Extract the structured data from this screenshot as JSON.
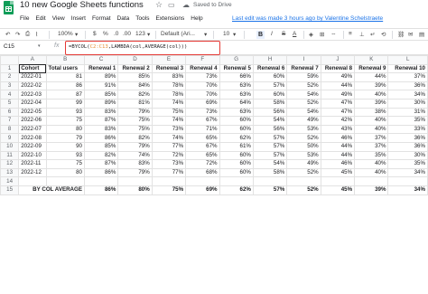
{
  "app": {
    "title": "10 new Google Sheets functions",
    "saved_status": "Saved to Drive",
    "last_edit": "Last edit was made 3 hours ago by Valentine Schelstraete",
    "icons": [
      "sheets-logo-icon",
      "star-icon",
      "folder-icon",
      "cloud-icon"
    ]
  },
  "menu": [
    "File",
    "Edit",
    "View",
    "Insert",
    "Format",
    "Data",
    "Tools",
    "Extensions",
    "Help"
  ],
  "toolbar": {
    "zoom": "100%",
    "currency": "$",
    "percent": "%",
    "decimal_dec": ".0",
    "decimal_inc": ".00",
    "more_formats": "123",
    "font": "Default (Ari...",
    "font_size": "10",
    "bold": "B"
  },
  "formula_bar": {
    "cell_ref": "C15",
    "fx": "fx",
    "formula_prefix": "=BYCOL(",
    "formula_range": "C2:C13",
    "formula_suffix": ",LAMBDA(col,AVERAGE(col)))"
  },
  "grid": {
    "columns": [
      "A",
      "B",
      "C",
      "D",
      "E",
      "F",
      "G",
      "H",
      "I",
      "J",
      "K",
      "L"
    ],
    "header_row": [
      "Cohort",
      "Total users",
      "Renewal 1",
      "Renewal 2",
      "Renewal 3",
      "Renewal 4",
      "Renewal 5",
      "Renewal 6",
      "Renewal 7",
      "Renewal 8",
      "Renewal 9",
      "Renewal 10"
    ],
    "rows": [
      [
        "2022-01",
        "81",
        "89%",
        "85%",
        "83%",
        "73%",
        "66%",
        "60%",
        "59%",
        "49%",
        "44%",
        "37%"
      ],
      [
        "2022-02",
        "86",
        "91%",
        "84%",
        "78%",
        "70%",
        "63%",
        "57%",
        "52%",
        "44%",
        "39%",
        "36%"
      ],
      [
        "2022-03",
        "87",
        "85%",
        "82%",
        "78%",
        "70%",
        "63%",
        "60%",
        "54%",
        "49%",
        "40%",
        "34%"
      ],
      [
        "2022-04",
        "99",
        "89%",
        "81%",
        "74%",
        "69%",
        "64%",
        "58%",
        "52%",
        "47%",
        "39%",
        "30%"
      ],
      [
        "2022-05",
        "93",
        "83%",
        "79%",
        "75%",
        "73%",
        "63%",
        "56%",
        "54%",
        "47%",
        "38%",
        "31%"
      ],
      [
        "2022-06",
        "75",
        "87%",
        "75%",
        "74%",
        "67%",
        "60%",
        "54%",
        "49%",
        "42%",
        "40%",
        "35%"
      ],
      [
        "2022-07",
        "80",
        "83%",
        "75%",
        "73%",
        "71%",
        "60%",
        "56%",
        "53%",
        "43%",
        "40%",
        "33%"
      ],
      [
        "2022-08",
        "79",
        "86%",
        "82%",
        "74%",
        "65%",
        "62%",
        "57%",
        "52%",
        "46%",
        "37%",
        "36%"
      ],
      [
        "2022-09",
        "90",
        "85%",
        "79%",
        "77%",
        "67%",
        "61%",
        "57%",
        "50%",
        "44%",
        "37%",
        "36%"
      ],
      [
        "2022-10",
        "93",
        "82%",
        "74%",
        "72%",
        "65%",
        "60%",
        "57%",
        "53%",
        "44%",
        "35%",
        "30%"
      ],
      [
        "2022-11",
        "75",
        "87%",
        "83%",
        "73%",
        "72%",
        "60%",
        "54%",
        "49%",
        "46%",
        "40%",
        "35%"
      ],
      [
        "2022-12",
        "80",
        "86%",
        "79%",
        "77%",
        "68%",
        "60%",
        "58%",
        "52%",
        "45%",
        "40%",
        "34%"
      ]
    ],
    "summary_label": "BY COL AVERAGE",
    "summary": [
      "86%",
      "80%",
      "75%",
      "69%",
      "62%",
      "57%",
      "52%",
      "45%",
      "39%",
      "34%"
    ]
  }
}
